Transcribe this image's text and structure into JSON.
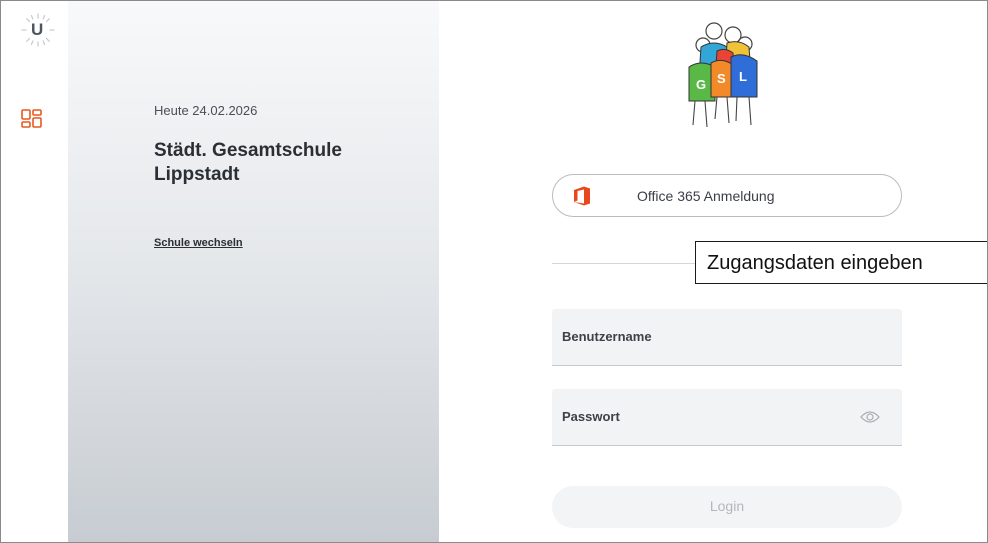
{
  "rail": {
    "logo_letter": "U",
    "logo_icon": "untis-logo-icon",
    "dashboard_icon": "dashboard-grid-icon",
    "accent_color": "#e8581c"
  },
  "info": {
    "date": "Heute 24.02.2026",
    "school_name": "Städt. Gesamtschule Lippstadt",
    "switch_school": "Schule wechseln"
  },
  "login": {
    "school_logo_letters": [
      "G",
      "S",
      "L"
    ],
    "office365_label": "Office 365 Anmeldung",
    "office365_icon": "office365-icon",
    "tooltip_text": "Zugangsdaten eingeben",
    "username_placeholder": "Benutzername",
    "password_placeholder": "Passwort",
    "show_password_icon": "eye-icon",
    "login_label": "Login"
  }
}
